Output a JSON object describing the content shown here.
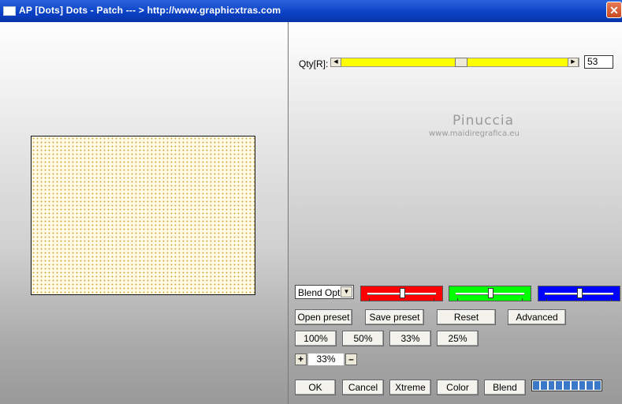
{
  "window": {
    "title": "AP [Dots]  Dots - Patch    --- > http://www.graphicxtras.com",
    "close_glyph": "✕"
  },
  "qty": {
    "label": "Qty[R]:",
    "value": "53",
    "fraction": 0.53
  },
  "watermark": {
    "name": "Pinuccia",
    "url": "www.maidiregrafica.eu"
  },
  "blend_select": {
    "value": "Blend Options"
  },
  "color_sliders": [
    {
      "name": "red",
      "color": "#ff0000",
      "position": 0.5
    },
    {
      "name": "green",
      "color": "#00ff00",
      "position": 0.5
    },
    {
      "name": "blue",
      "color": "#0000ff",
      "position": 0.5
    }
  ],
  "buttons": {
    "open_preset": "Open preset",
    "save_preset": "Save preset",
    "reset": "Reset",
    "advanced": "Advanced",
    "zoom_100": "100%",
    "zoom_50": "50%",
    "zoom_33": "33%",
    "zoom_25": "25%",
    "ok": "OK",
    "cancel": "Cancel",
    "xtreme": "Xtreme",
    "color": "Color",
    "blend": "Blend"
  },
  "zoom": {
    "plus": "+",
    "minus": "–",
    "value": "33%"
  },
  "progress": {
    "segments": 9
  },
  "colors": {
    "titlebar": "#0a40c4",
    "slider_track": "#ffff00",
    "dots": "#d6aa3c",
    "preview_bg": "#fffbe6"
  }
}
